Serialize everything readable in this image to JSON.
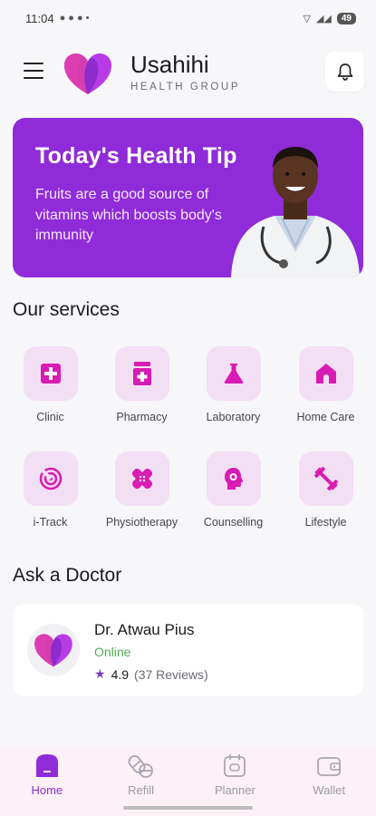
{
  "status_bar": {
    "time": "11:04",
    "battery": "49"
  },
  "header": {
    "brand_name": "Usahihi",
    "brand_sub": "HEALTH GROUP"
  },
  "health_tip": {
    "title": "Today's Health Tip",
    "text": "Fruits are a good source of vitamins which boosts body's immunity"
  },
  "services": {
    "title": "Our services",
    "items": [
      {
        "label": "Clinic",
        "icon": "medical-cross-icon"
      },
      {
        "label": "Pharmacy",
        "icon": "pill-bottle-icon"
      },
      {
        "label": "Laboratory",
        "icon": "flask-icon"
      },
      {
        "label": "Home Care",
        "icon": "home-icon"
      },
      {
        "label": "i-Track",
        "icon": "tracking-icon"
      },
      {
        "label": "Physiotherapy",
        "icon": "bandage-icon"
      },
      {
        "label": "Counselling",
        "icon": "head-gear-icon"
      },
      {
        "label": "Lifestyle",
        "icon": "dumbbell-icon"
      }
    ]
  },
  "ask_doctor": {
    "title": "Ask a Doctor",
    "doctor": {
      "name": "Dr. Atwau Pius",
      "status": "Online",
      "rating": "4.9",
      "reviews": "(37 Reviews)"
    }
  },
  "bottom_nav": [
    {
      "label": "Home",
      "active": true
    },
    {
      "label": "Refill",
      "active": false
    },
    {
      "label": "Planner",
      "active": false
    },
    {
      "label": "Wallet",
      "active": false
    }
  ],
  "colors": {
    "accent": "#8f2bd8",
    "service_tile": "#f3dff4",
    "service_icon": "#d81bb3",
    "online": "#4caf50"
  }
}
